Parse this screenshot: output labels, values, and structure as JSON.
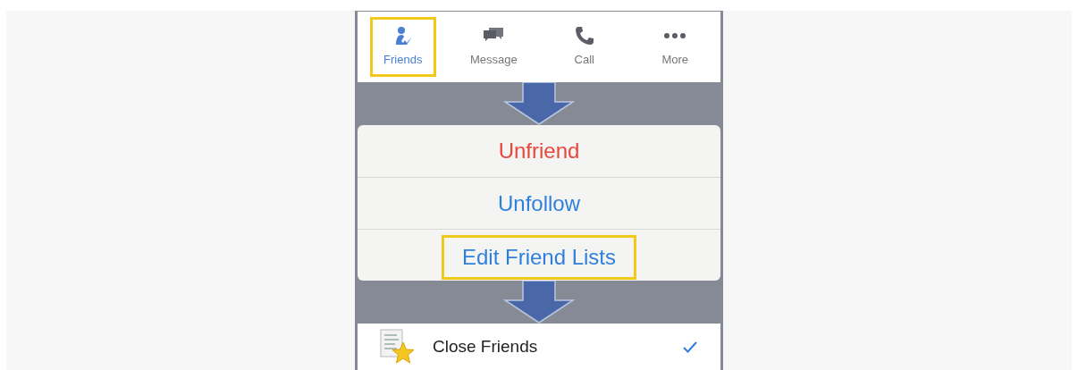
{
  "tabs": [
    {
      "label": "Friends",
      "kind": "friends",
      "selected": true,
      "highlighted": true
    },
    {
      "label": "Message",
      "kind": "message",
      "selected": false,
      "highlighted": false
    },
    {
      "label": "Call",
      "kind": "call",
      "selected": false,
      "highlighted": false
    },
    {
      "label": "More",
      "kind": "more",
      "selected": false,
      "highlighted": false
    }
  ],
  "actions": [
    {
      "label": "Unfriend",
      "kind": "destructive",
      "highlighted": false
    },
    {
      "label": "Unfollow",
      "kind": "normal",
      "highlighted": false
    },
    {
      "label": "Edit Friend Lists",
      "kind": "normal",
      "highlighted": true
    }
  ],
  "lists": [
    {
      "label": "Close Friends",
      "checked": true
    }
  ]
}
